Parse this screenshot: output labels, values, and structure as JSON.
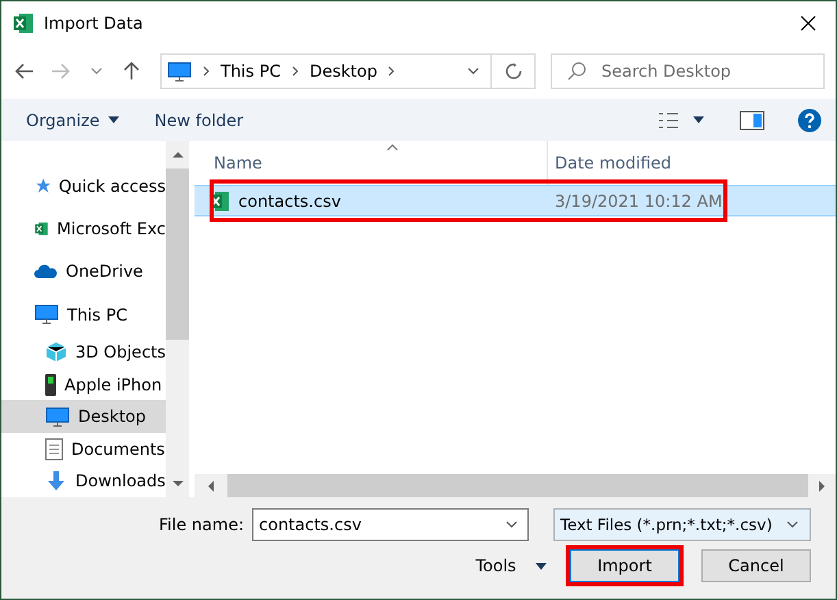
{
  "window": {
    "title": "Import Data"
  },
  "address": {
    "crumbs": [
      "This PC",
      "Desktop"
    ]
  },
  "search": {
    "placeholder": "Search Desktop"
  },
  "toolbar": {
    "organize": "Organize",
    "new_folder": "New folder"
  },
  "sidebar": {
    "items": [
      {
        "label": "Quick access",
        "selected": false
      },
      {
        "label": "Microsoft Exc",
        "selected": false
      },
      {
        "label": "OneDrive",
        "selected": false
      },
      {
        "label": "This PC",
        "selected": false,
        "children": [
          {
            "label": "3D Objects",
            "selected": false
          },
          {
            "label": "Apple iPhon",
            "selected": false
          },
          {
            "label": "Desktop",
            "selected": true
          },
          {
            "label": "Documents",
            "selected": false
          },
          {
            "label": "Downloads",
            "selected": false
          }
        ]
      }
    ]
  },
  "file_list": {
    "columns": [
      "Name",
      "Date modified"
    ],
    "rows": [
      {
        "name": "contacts.csv",
        "date": "3/19/2021 10:12 AM",
        "selected": true,
        "highlighted": true
      }
    ]
  },
  "file_name": {
    "label": "File name:",
    "value": "contacts.csv"
  },
  "file_type": {
    "value": "Text Files (*.prn;*.txt;*.csv)"
  },
  "buttons": [
    {
      "kind": "menu",
      "label": "Tools",
      "highlighted": false
    },
    {
      "kind": "primary",
      "label": "Import",
      "highlighted": true
    },
    {
      "kind": "normal",
      "label": "Cancel",
      "highlighted": false
    }
  ]
}
